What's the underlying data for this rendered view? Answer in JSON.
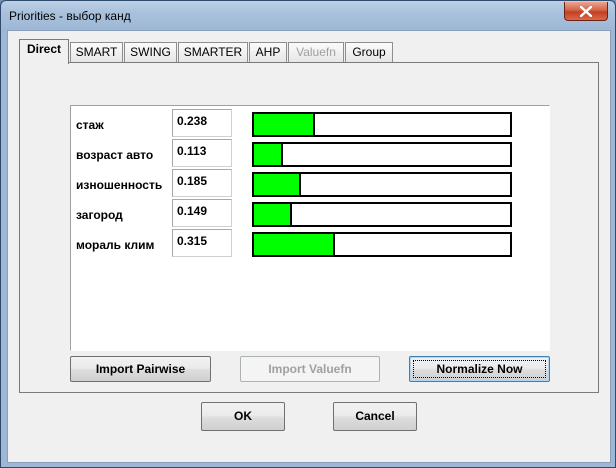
{
  "window": {
    "title": "Priorities - выбор канд"
  },
  "tabs": [
    {
      "label": "Direct",
      "active": true,
      "disabled": false
    },
    {
      "label": "SMART",
      "active": false,
      "disabled": false
    },
    {
      "label": "SWING",
      "active": false,
      "disabled": false
    },
    {
      "label": "SMARTER",
      "active": false,
      "disabled": false
    },
    {
      "label": "AHP",
      "active": false,
      "disabled": false
    },
    {
      "label": "Valuefn",
      "active": false,
      "disabled": true
    },
    {
      "label": "Group",
      "active": false,
      "disabled": false
    }
  ],
  "criteria": [
    {
      "label": "стаж",
      "value": "0.238",
      "weight": 0.238
    },
    {
      "label": "возраст авто",
      "value": "0.113",
      "weight": 0.113
    },
    {
      "label": "изношенность",
      "value": "0.185",
      "weight": 0.185
    },
    {
      "label": "загород",
      "value": "0.149",
      "weight": 0.149
    },
    {
      "label": "мораль клим",
      "value": "0.315",
      "weight": 0.315
    }
  ],
  "actions": {
    "import_pairwise": "Import Pairwise",
    "import_valuefn": "Import Valuefn",
    "normalize_now": "Normalize Now"
  },
  "dialog": {
    "ok": "OK",
    "cancel": "Cancel"
  },
  "colors": {
    "bar_fill": "#00ff00",
    "close_button": "#c43f22"
  }
}
